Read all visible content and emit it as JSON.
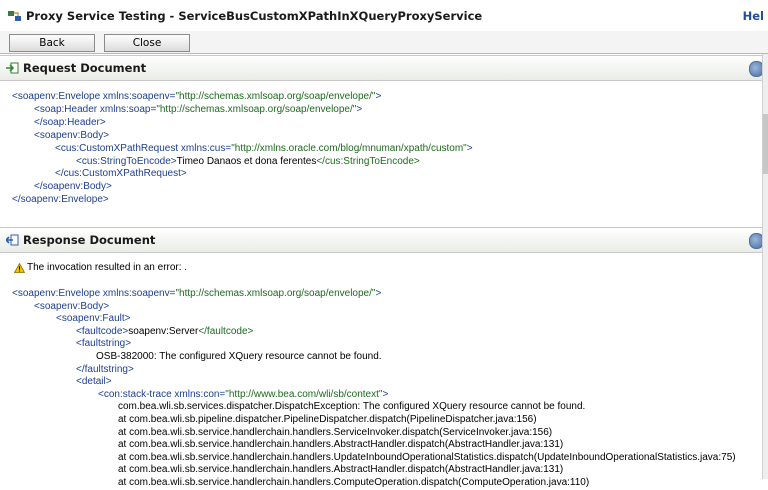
{
  "window": {
    "title": "Proxy Service Testing - ServiceBusCustomXPathInXQueryProxyService",
    "help_label": "Hel"
  },
  "toolbar": {
    "back_label": "Back",
    "close_label": "Close"
  },
  "request": {
    "title": "Request Document",
    "lines": [
      [
        "<soapenv:Envelope ",
        "xmlns:soapenv=",
        "\"http://schemas.xmlsoap.org/soap/envelope/\"",
        ">"
      ],
      [
        "<soap:Header ",
        "xmlns:soap=",
        "\"http://schemas.xmlsoap.org/soap/envelope/\"",
        ">"
      ],
      [
        "</soap:Header>",
        "",
        "",
        ""
      ],
      [
        "<soapenv:Body>",
        "",
        "",
        ""
      ],
      [
        "<cus:CustomXPathRequest ",
        "xmlns:cus=",
        "\"http://xmlns.oracle.com/blog/mnuman/xpath/custom\"",
        ">"
      ],
      [
        "<cus:StringToEncode>",
        "Timeo Danaos et dona ferentes",
        "</cus:StringToEncode>",
        ""
      ],
      [
        "</cus:CustomXPathRequest>",
        "",
        "",
        ""
      ],
      [
        "</soapenv:Body>",
        "",
        "",
        ""
      ],
      [
        "</soapenv:Envelope>",
        "",
        "",
        ""
      ]
    ]
  },
  "response": {
    "title": "Response Document",
    "error_message": "The invocation resulted in an error: .",
    "lines": [
      [
        "<soapenv:Envelope ",
        "xmlns:soapenv=",
        "\"http://schemas.xmlsoap.org/soap/envelope/\"",
        ">"
      ],
      [
        "<soapenv:Body>",
        "",
        "",
        ""
      ],
      [
        "<soapenv:Fault>",
        "",
        "",
        ""
      ],
      [
        "<faultcode>",
        "soapenv:Server",
        "</faultcode>",
        ""
      ],
      [
        "<faultstring>",
        "",
        "",
        ""
      ],
      [
        "",
        "OSB-382000: The configured XQuery resource cannot be found.",
        "",
        ""
      ],
      [
        "</faultstring>",
        "",
        "",
        ""
      ],
      [
        "<detail>",
        "",
        "",
        ""
      ],
      [
        "<con:stack-trace ",
        "xmlns:con=",
        "\"http://www.bea.com/wli/sb/context\"",
        ">"
      ],
      [
        "",
        "com.bea.wli.sb.services.dispatcher.DispatchException: The configured XQuery resource cannot be found.",
        "",
        ""
      ],
      [
        "",
        "at com.bea.wli.sb.pipeline.dispatcher.PipelineDispatcher.dispatch(PipelineDispatcher.java:156)",
        "",
        ""
      ],
      [
        "",
        "at com.bea.wli.sb.service.handlerchain.handlers.ServiceInvoker.dispatch(ServiceInvoker.java:156)",
        "",
        ""
      ],
      [
        "",
        "at com.bea.wli.sb.service.handlerchain.handlers.AbstractHandler.dispatch(AbstractHandler.java:131)",
        "",
        ""
      ],
      [
        "",
        "at com.bea.wli.sb.service.handlerchain.handlers.UpdateInboundOperationalStatistics.dispatch(UpdateInboundOperationalStatistics.java:75)",
        "",
        ""
      ],
      [
        "",
        "at com.bea.wli.sb.service.handlerchain.handlers.AbstractHandler.dispatch(AbstractHandler.java:131)",
        "",
        ""
      ],
      [
        "",
        "at com.bea.wli.sb.service.handlerchain.handlers.ComputeOperation.dispatch(ComputeOperation.java:110)",
        "",
        ""
      ]
    ]
  },
  "icons": {
    "app": "proxy-service-icon",
    "request": "request-arrow-icon",
    "response": "response-arrow-icon",
    "warning": "warning-icon",
    "collapse": "collapse-icon"
  }
}
